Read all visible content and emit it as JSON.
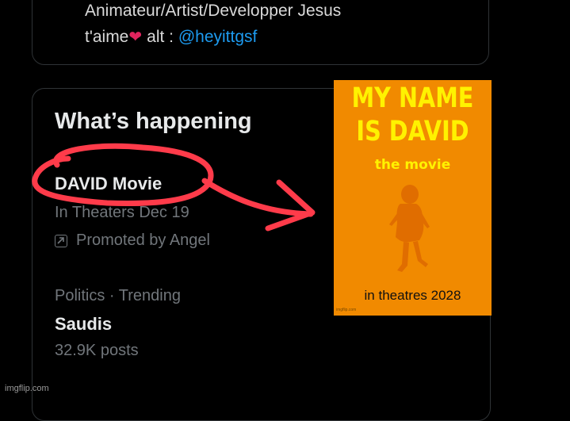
{
  "profile": {
    "bio_line1": "Animateur/Artist/Developper Jesus",
    "bio_line2_prefix": "t'aime",
    "bio_line2_mid": "alt :",
    "handle": "@heyittgsf"
  },
  "trends": {
    "title": "What’s happening",
    "items": [
      {
        "name": "DAVID Movie",
        "subtitle": "In Theaters Dec 19",
        "promoted": "Promoted by Angel"
      },
      {
        "context": "Politics · Trending",
        "name": "Saudis",
        "posts": "32.9K posts"
      }
    ]
  },
  "poster": {
    "title_line1": "MY NAME",
    "title_line2": "IS DAVID",
    "subtitle": "the movie",
    "footer": "in theatres 2028",
    "credit": "imgflip.com",
    "background_color": "#f18a00",
    "title_color": "#fff200",
    "silhouette_color": "#e06d00"
  },
  "annotation": {
    "stroke_color": "#ff3b4a",
    "shapes": [
      "circle-outline",
      "arrow"
    ]
  },
  "watermark": "imgflip.com"
}
